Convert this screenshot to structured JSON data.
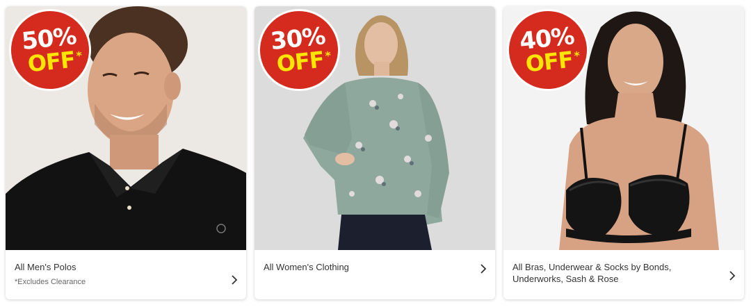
{
  "cards": [
    {
      "badge": {
        "percent": "50%",
        "off": "OFF",
        "asterisk": "*"
      },
      "title": "All Men's Polos",
      "subtitle": "*Excludes Clearance"
    },
    {
      "badge": {
        "percent": "30%",
        "off": "OFF",
        "asterisk": "*"
      },
      "title": "All Women's Clothing",
      "subtitle": ""
    },
    {
      "badge": {
        "percent": "40%",
        "off": "OFF",
        "asterisk": "*"
      },
      "title": "All Bras, Underwear & Socks by Bonds, Underworks, Sash & Rose",
      "subtitle": ""
    }
  ],
  "colors": {
    "badge_red": "#d52b1e",
    "badge_yellow": "#ffe600",
    "text": "#333333"
  }
}
